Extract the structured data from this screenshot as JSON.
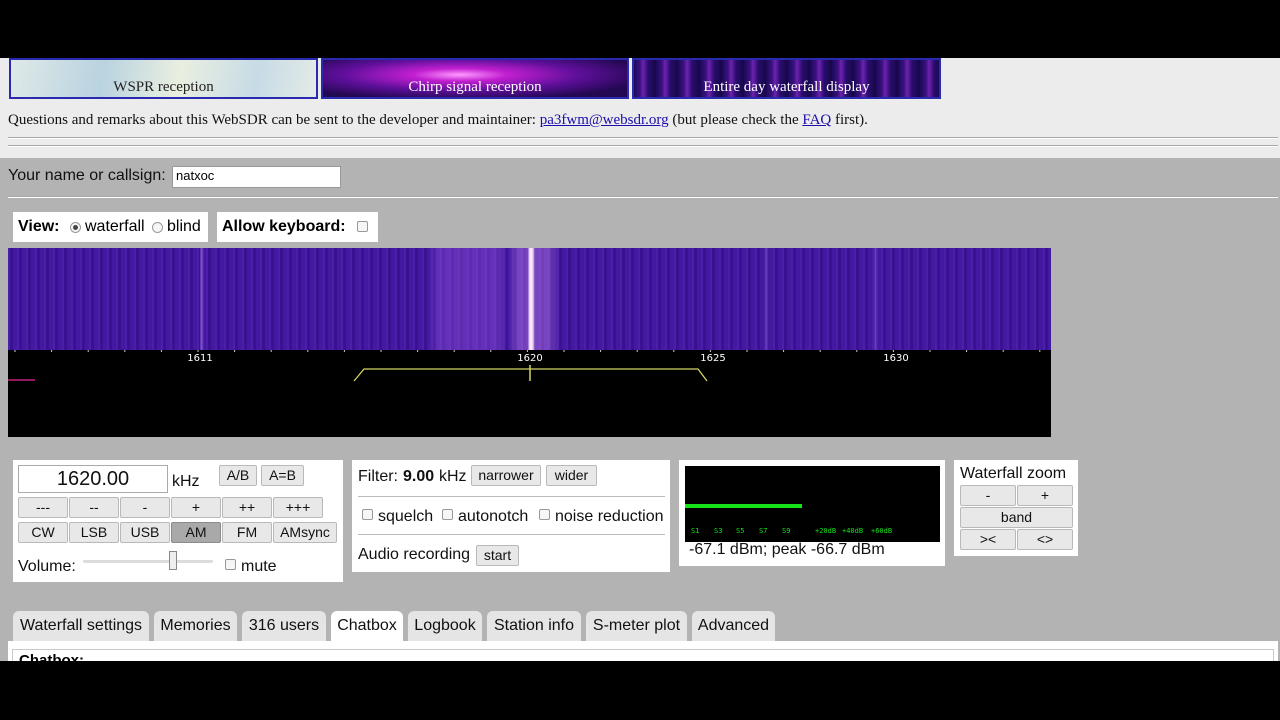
{
  "thumbnails": [
    {
      "label": "WSPR reception"
    },
    {
      "label": "Chirp signal reception"
    },
    {
      "label": "Entire day waterfall display"
    }
  ],
  "remark": {
    "text_before": "Questions and remarks about this WebSDR can be sent to the developer and maintainer: ",
    "email": "pa3fwm@websdr.org",
    "text_middle": " (but please check the ",
    "faq": "FAQ",
    "text_after": " first)."
  },
  "callsign": {
    "label": "Your name or callsign:",
    "value": "natxoc"
  },
  "view": {
    "label": "View:",
    "waterfall": "waterfall",
    "blind": "blind",
    "selected": "waterfall"
  },
  "keyboard": {
    "label": "Allow keyboard:",
    "checked": false
  },
  "waterfall_scale": {
    "ticks": [
      "1611",
      "1620",
      "1625",
      "1630"
    ]
  },
  "tuning": {
    "frequency": "1620.00",
    "unit": "kHz",
    "ab": "A/B",
    "a_eq_b": "A=B",
    "step_buttons": [
      "---",
      "--",
      "-",
      "+",
      "++",
      "+++"
    ],
    "modes": [
      "CW",
      "LSB",
      "USB",
      "AM",
      "FM",
      "AMsync"
    ],
    "active_mode": "AM",
    "volume_label": "Volume:",
    "mute_label": "mute",
    "volume_level": 0.69
  },
  "filter": {
    "label": "Filter:",
    "bandwidth": "9.00",
    "unit": "kHz",
    "narrower": "narrower",
    "wider": "wider",
    "squelch": "squelch",
    "autonotch": "autonotch",
    "noise_reduction": "noise reduction",
    "audio_recording": "Audio recording",
    "start": "start"
  },
  "smeter": {
    "scale": [
      "S1",
      "S3",
      "S5",
      "S7",
      "S9",
      "+20dB",
      "+40dB",
      "+60dB"
    ],
    "bar_fraction": 0.46,
    "readout": "-67.1 dBm; peak  -66.7 dBm",
    "bar_color": "#17e31a"
  },
  "zoom": {
    "title": "Waterfall zoom",
    "minus": "-",
    "plus": "+",
    "band": "band",
    "narrow": "><",
    "wide": "<>"
  },
  "tabs": [
    "Waterfall settings",
    "Memories",
    "316 users",
    "Chatbox",
    "Logbook",
    "Station info",
    "S-meter plot",
    "Advanced"
  ],
  "active_tab": "Chatbox",
  "chatbox_title": "Chatbox:"
}
